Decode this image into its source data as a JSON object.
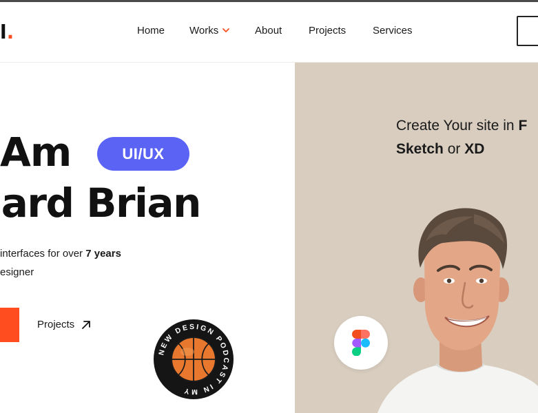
{
  "header": {
    "logo_text": "l",
    "logo_dot": ".",
    "nav": [
      {
        "label": "Home"
      },
      {
        "label": "Works",
        "has_dropdown": true
      },
      {
        "label": "About"
      },
      {
        "label": "Projects"
      },
      {
        "label": "Services"
      }
    ]
  },
  "hero": {
    "line1": "Am",
    "role_badge": "UI/UX",
    "line2": "hard Brian",
    "sub1_pre": "interfaces for over ",
    "sub1_bold": "7 years",
    "sub2": "esigner",
    "projects_link": "Projects"
  },
  "badge": {
    "ring_text": "NEW DESIGN PODCAST IN MY"
  },
  "panel": {
    "tagline_pre": "Create Your site in ",
    "tagline_bold_cut": "F",
    "tagline2_bold_a": "Sketch",
    "tagline2_mid": " or ",
    "tagline2_bold_b": "XD"
  },
  "colors": {
    "accent": "#ff4d1f",
    "badge_blue": "#5b63f5",
    "panel_bg": "#d8cdbf"
  },
  "icons": [
    "arrow-up-right-icon",
    "figma-icon",
    "basketball-icon",
    "chevron-down-icon"
  ]
}
